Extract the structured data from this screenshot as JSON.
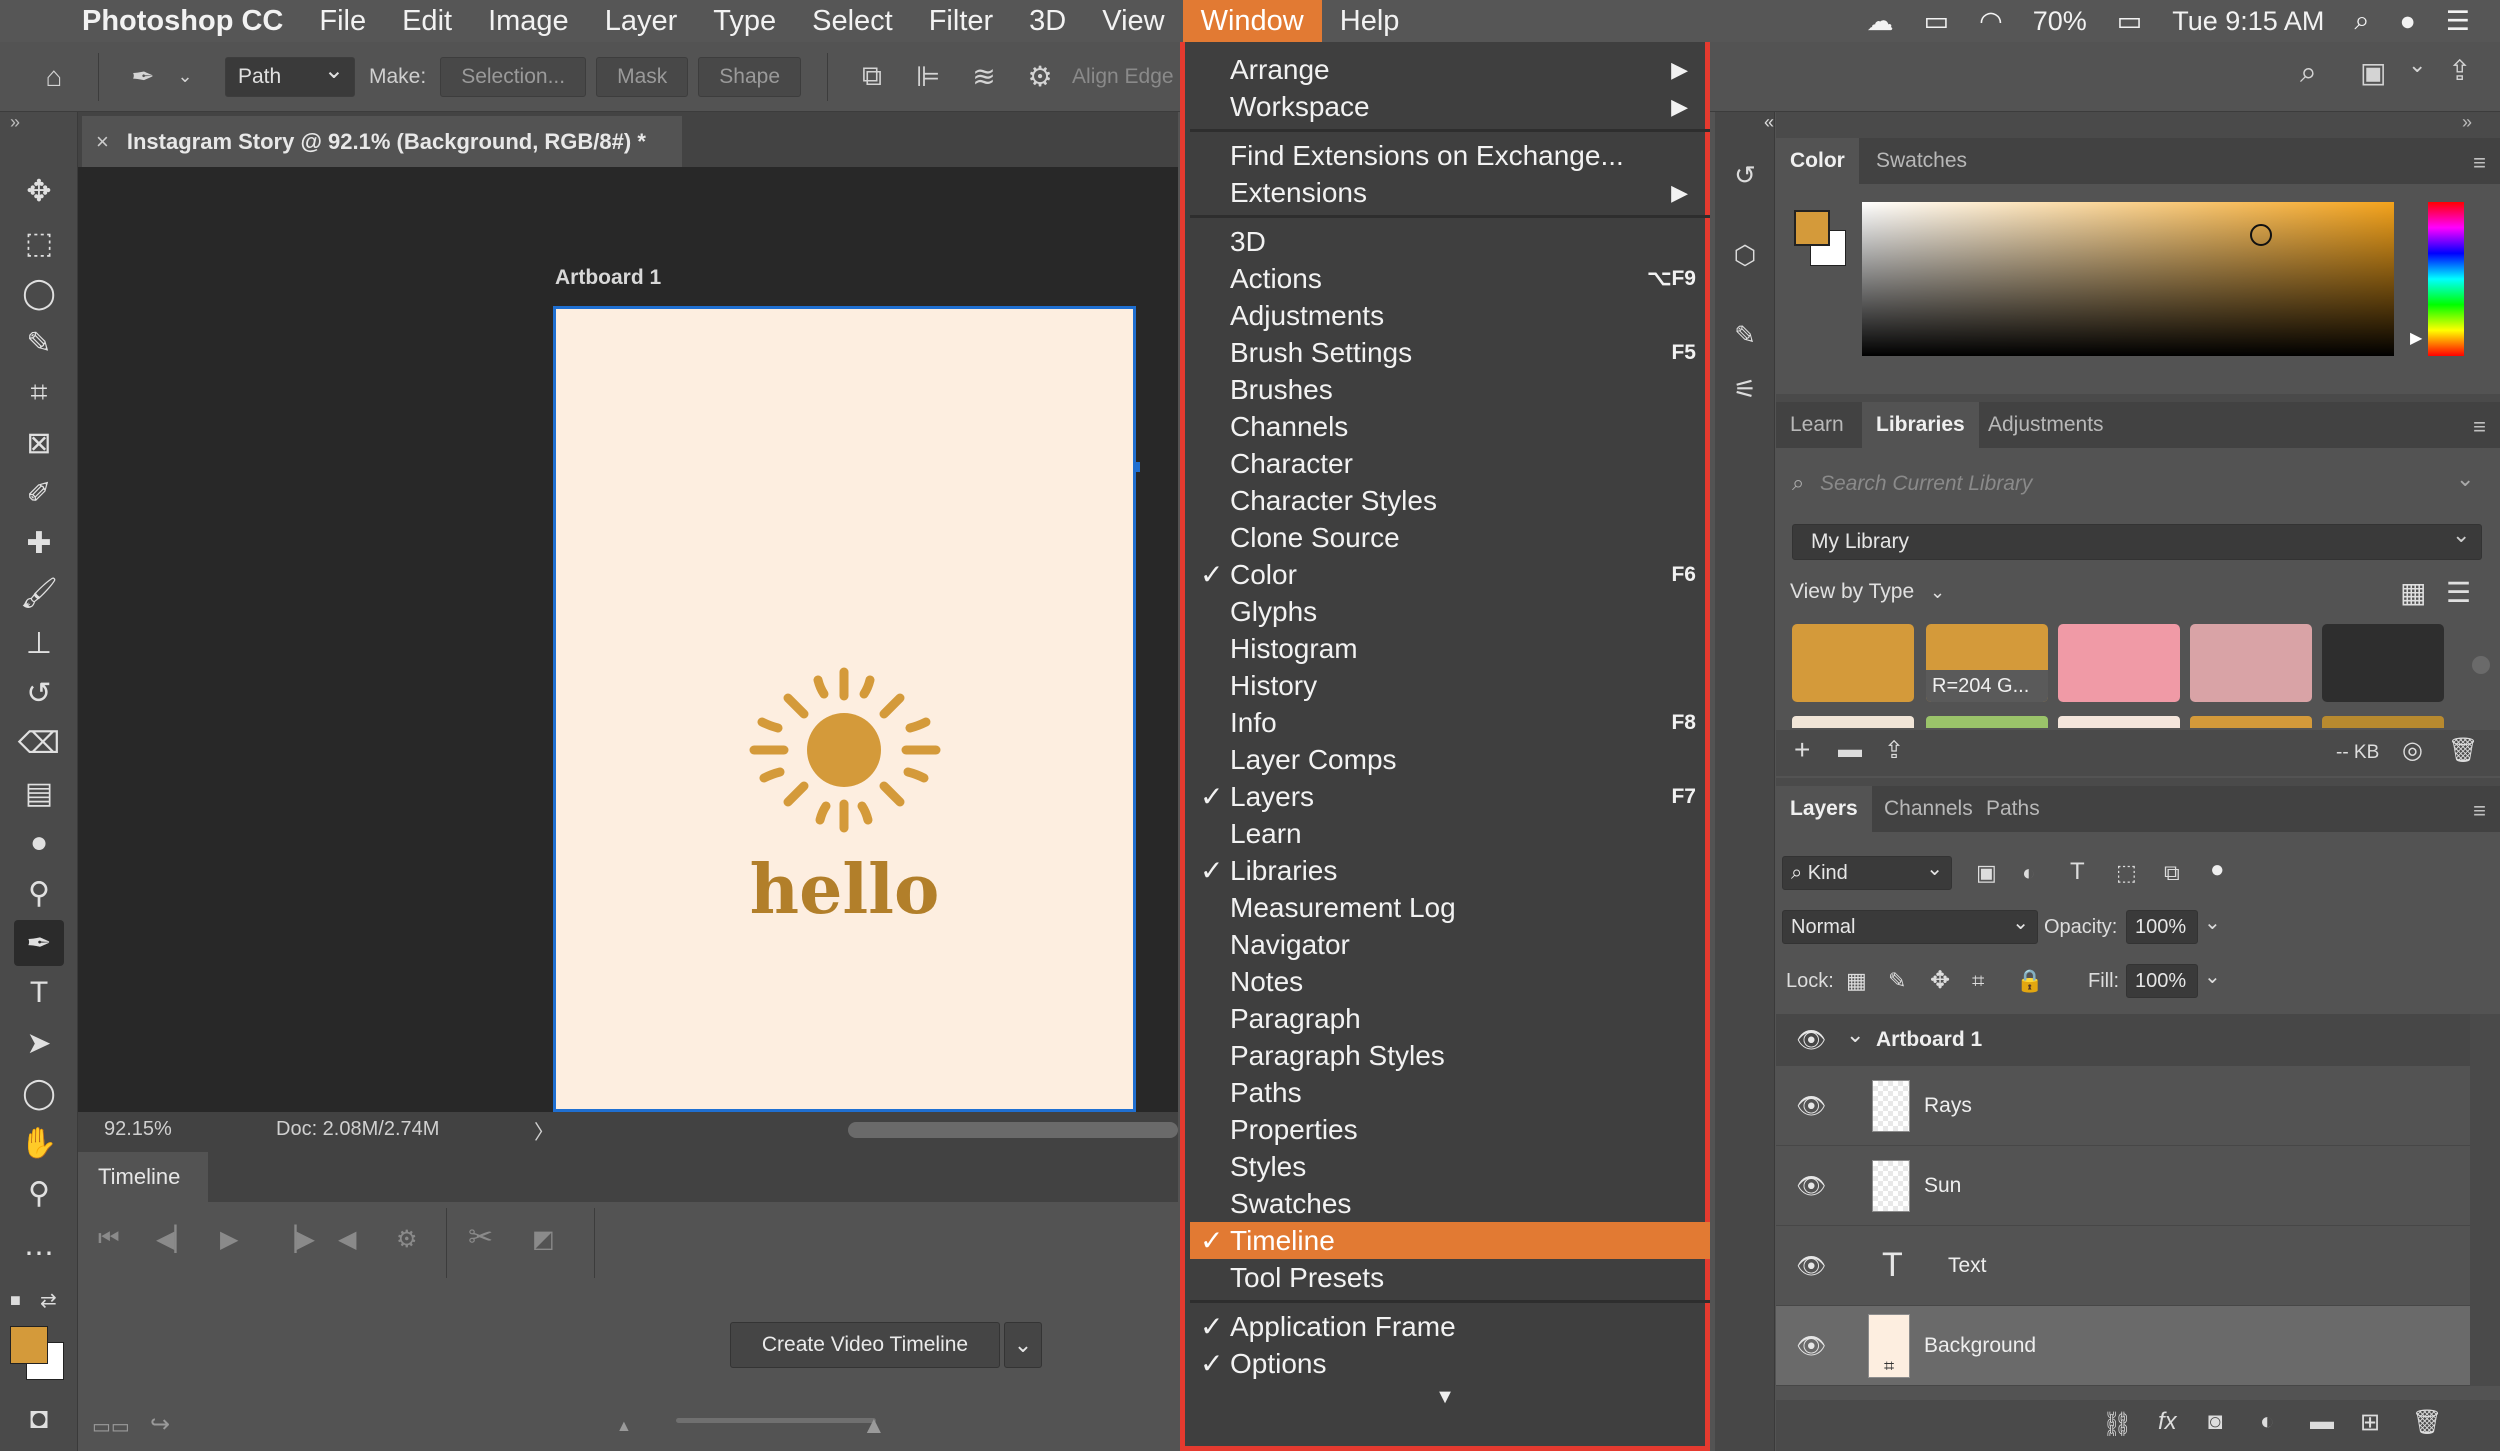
{
  "menubar": {
    "apple": "",
    "app_name": "Photoshop CC",
    "items": [
      "File",
      "Edit",
      "Image",
      "Layer",
      "Type",
      "Select",
      "Filter",
      "3D",
      "View",
      "Window",
      "Help"
    ],
    "active_item": "Window",
    "battery": "70%",
    "clock": "Tue 9:15 AM"
  },
  "options_bar": {
    "mode_select": "Path",
    "make_label": "Make:",
    "selection_btn": "Selection...",
    "mask_btn": "Mask",
    "shape_btn": "Shape",
    "align_edges": "Align Edge"
  },
  "document": {
    "tab_title": "Instagram Story @ 92.1% (Background, RGB/8#) *",
    "tab_close": "×",
    "artboard_label": "Artboard 1",
    "hello_text": "hello",
    "zoom": "92.15%",
    "doc_size": "Doc: 2.08M/2.74M",
    "status_arrow": "〉"
  },
  "timeline": {
    "tab_label": "Timeline",
    "create_button": "Create Video Timeline"
  },
  "window_menu": {
    "group1": [
      {
        "label": "Arrange",
        "submenu": true
      },
      {
        "label": "Workspace",
        "submenu": true
      }
    ],
    "group2": [
      {
        "label": "Find Extensions on Exchange...",
        "submenu": false
      },
      {
        "label": "Extensions",
        "submenu": true
      }
    ],
    "group3": [
      {
        "label": "3D",
        "checked": false,
        "shortcut": ""
      },
      {
        "label": "Actions",
        "checked": false,
        "shortcut": "⌥F9"
      },
      {
        "label": "Adjustments",
        "checked": false,
        "shortcut": ""
      },
      {
        "label": "Brush Settings",
        "checked": false,
        "shortcut": "F5"
      },
      {
        "label": "Brushes",
        "checked": false,
        "shortcut": ""
      },
      {
        "label": "Channels",
        "checked": false,
        "shortcut": ""
      },
      {
        "label": "Character",
        "checked": false,
        "shortcut": ""
      },
      {
        "label": "Character Styles",
        "checked": false,
        "shortcut": ""
      },
      {
        "label": "Clone Source",
        "checked": false,
        "shortcut": ""
      },
      {
        "label": "Color",
        "checked": true,
        "shortcut": "F6"
      },
      {
        "label": "Glyphs",
        "checked": false,
        "shortcut": ""
      },
      {
        "label": "Histogram",
        "checked": false,
        "shortcut": ""
      },
      {
        "label": "History",
        "checked": false,
        "shortcut": ""
      },
      {
        "label": "Info",
        "checked": false,
        "shortcut": "F8"
      },
      {
        "label": "Layer Comps",
        "checked": false,
        "shortcut": ""
      },
      {
        "label": "Layers",
        "checked": true,
        "shortcut": "F7"
      },
      {
        "label": "Learn",
        "checked": false,
        "shortcut": ""
      },
      {
        "label": "Libraries",
        "checked": true,
        "shortcut": ""
      },
      {
        "label": "Measurement Log",
        "checked": false,
        "shortcut": ""
      },
      {
        "label": "Navigator",
        "checked": false,
        "shortcut": ""
      },
      {
        "label": "Notes",
        "checked": false,
        "shortcut": ""
      },
      {
        "label": "Paragraph",
        "checked": false,
        "shortcut": ""
      },
      {
        "label": "Paragraph Styles",
        "checked": false,
        "shortcut": ""
      },
      {
        "label": "Paths",
        "checked": false,
        "shortcut": ""
      },
      {
        "label": "Properties",
        "checked": false,
        "shortcut": ""
      },
      {
        "label": "Styles",
        "checked": false,
        "shortcut": ""
      },
      {
        "label": "Swatches",
        "checked": false,
        "shortcut": ""
      },
      {
        "label": "Timeline",
        "checked": true,
        "shortcut": "",
        "highlighted": true
      },
      {
        "label": "Tool Presets",
        "checked": false,
        "shortcut": ""
      }
    ],
    "group4": [
      {
        "label": "Application Frame",
        "checked": true
      },
      {
        "label": "Options",
        "checked": true
      }
    ],
    "check_glyph": "✓",
    "submenu_glyph": "▶",
    "more_glyph": "▼"
  },
  "color_panel": {
    "tabs": [
      "Color",
      "Swatches"
    ],
    "active_tab": "Color",
    "foreground": "#d49a3a",
    "background": "#ffffff"
  },
  "libraries_panel": {
    "tabs": [
      "Learn",
      "Libraries",
      "Adjustments"
    ],
    "active_tab": "Libraries",
    "search_placeholder": "Search Current Library",
    "library_name": "My Library",
    "view_by": "View by Type",
    "swatches": [
      {
        "color": "#d49a3a",
        "label": ""
      },
      {
        "color": "#d49a3a",
        "label": "R=204 G..."
      },
      {
        "color": "#f09aa6",
        "label": ""
      },
      {
        "color": "#d9a3a6",
        "label": ""
      },
      {
        "color": "#2e2e2e",
        "label": ""
      }
    ],
    "size_text": "-- KB"
  },
  "layers_panel": {
    "tabs": [
      "Layers",
      "Channels",
      "Paths"
    ],
    "active_tab": "Layers",
    "filter_kind": "Kind",
    "blend_mode": "Normal",
    "opacity_label": "Opacity:",
    "opacity_value": "100%",
    "lock_label": "Lock:",
    "fill_label": "Fill:",
    "fill_value": "100%",
    "artboard_group": "Artboard 1",
    "layers": [
      {
        "name": "Rays",
        "kind": "pixel",
        "selected": false
      },
      {
        "name": "Sun",
        "kind": "pixel",
        "selected": false
      },
      {
        "name": "Text",
        "kind": "type",
        "selected": false
      },
      {
        "name": "Background",
        "kind": "background",
        "selected": true
      }
    ]
  }
}
